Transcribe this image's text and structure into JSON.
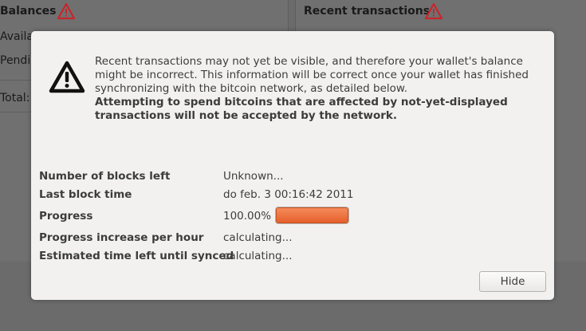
{
  "background": {
    "balances_title": "Balances",
    "available_label": "Availa",
    "pending_label": "Pendin",
    "total_label": "Total:",
    "recent_title": "Recent transactions"
  },
  "dialog": {
    "message_line1": "Recent transactions may not yet be visible, and therefore your wallet's balance might be incorrect. This information will be correct once your wallet has finished synchronizing with the bitcoin network, as detailed below.",
    "message_bold": "Attempting to spend bitcoins that are affected by not-yet-displayed transactions will not be accepted by the network.",
    "rows": {
      "blocks_left": {
        "label": "Number of blocks left",
        "value": "Unknown..."
      },
      "last_block": {
        "label": "Last block time",
        "value": "do feb. 3 00:16:42 2011"
      },
      "progress": {
        "label": "Progress",
        "value": "100.00%",
        "fraction": 1.0
      },
      "increase": {
        "label": "Progress increase per hour",
        "value": "calculating..."
      },
      "eta": {
        "label": "Estimated time left until synced",
        "value": "calculating..."
      }
    },
    "hide_label": "Hide"
  },
  "colors": {
    "progress_fill": "#e5602c",
    "warning_icon": "#c7262c"
  },
  "icons": {
    "dialog_icon": "warning-triangle-icon",
    "panel_warning": "warning-triangle-icon"
  }
}
